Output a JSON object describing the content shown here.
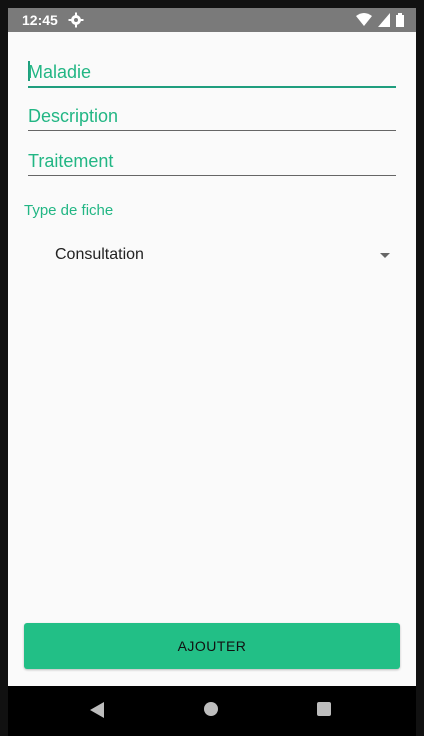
{
  "status_bar": {
    "time": "12:45",
    "icons": [
      "gear-icon",
      "wifi-icon",
      "cellular-icon",
      "battery-icon"
    ]
  },
  "form": {
    "fields": [
      {
        "placeholder": "Maladie",
        "focused": true
      },
      {
        "placeholder": "Description",
        "focused": false
      },
      {
        "placeholder": "Traitement",
        "focused": false
      }
    ],
    "type_label": "Type de fiche",
    "type_selected": "Consultation",
    "submit_label": "AJOUTER"
  },
  "colors": {
    "accent": "#22b684",
    "button": "#22bf86",
    "background": "#fafafa",
    "status_bar": "#7a7a7a"
  },
  "nav_bar": {
    "icons": [
      "back-icon",
      "home-icon",
      "recents-icon"
    ]
  }
}
